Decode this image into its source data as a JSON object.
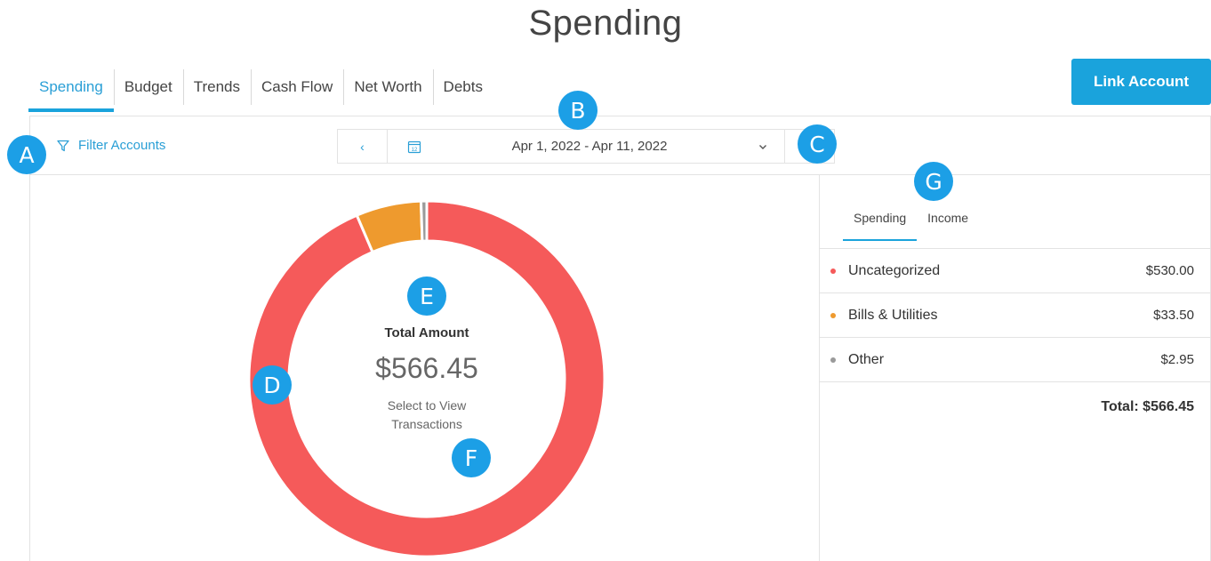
{
  "page": {
    "title": "Spending"
  },
  "nav": {
    "tabs": [
      {
        "label": "Spending"
      },
      {
        "label": "Budget"
      },
      {
        "label": "Trends"
      },
      {
        "label": "Cash Flow"
      },
      {
        "label": "Net Worth"
      },
      {
        "label": "Debts"
      }
    ],
    "active": "Spending"
  },
  "header": {
    "link_account_label": "Link Account"
  },
  "filter": {
    "label": "Filter Accounts",
    "icon": "funnel-icon"
  },
  "date_range": {
    "label": "Apr 1, 2022 - Apr 11, 2022",
    "prev_glyph": "‹",
    "next_glyph": "›",
    "calendar_day": "12",
    "dropdown_glyph": "⌄"
  },
  "summary": {
    "label": "Total Amount",
    "amount": "$566.45",
    "hint_line1": "Select to View",
    "hint_line2": "Transactions"
  },
  "side_tabs": [
    {
      "label": "Spending"
    },
    {
      "label": "Income"
    }
  ],
  "categories": [
    {
      "name": "Uncategorized",
      "amount": "$530.00",
      "value": 530.0,
      "color": "#f55a5a"
    },
    {
      "name": "Bills & Utilities",
      "amount": "$33.50",
      "value": 33.5,
      "color": "#ee9a2e"
    },
    {
      "name": "Other",
      "amount": "$2.95",
      "value": 2.95,
      "color": "#9a9a9a"
    }
  ],
  "total_label": "Total: $566.45",
  "callouts": [
    "A",
    "B",
    "C",
    "D",
    "E",
    "F",
    "G"
  ]
}
